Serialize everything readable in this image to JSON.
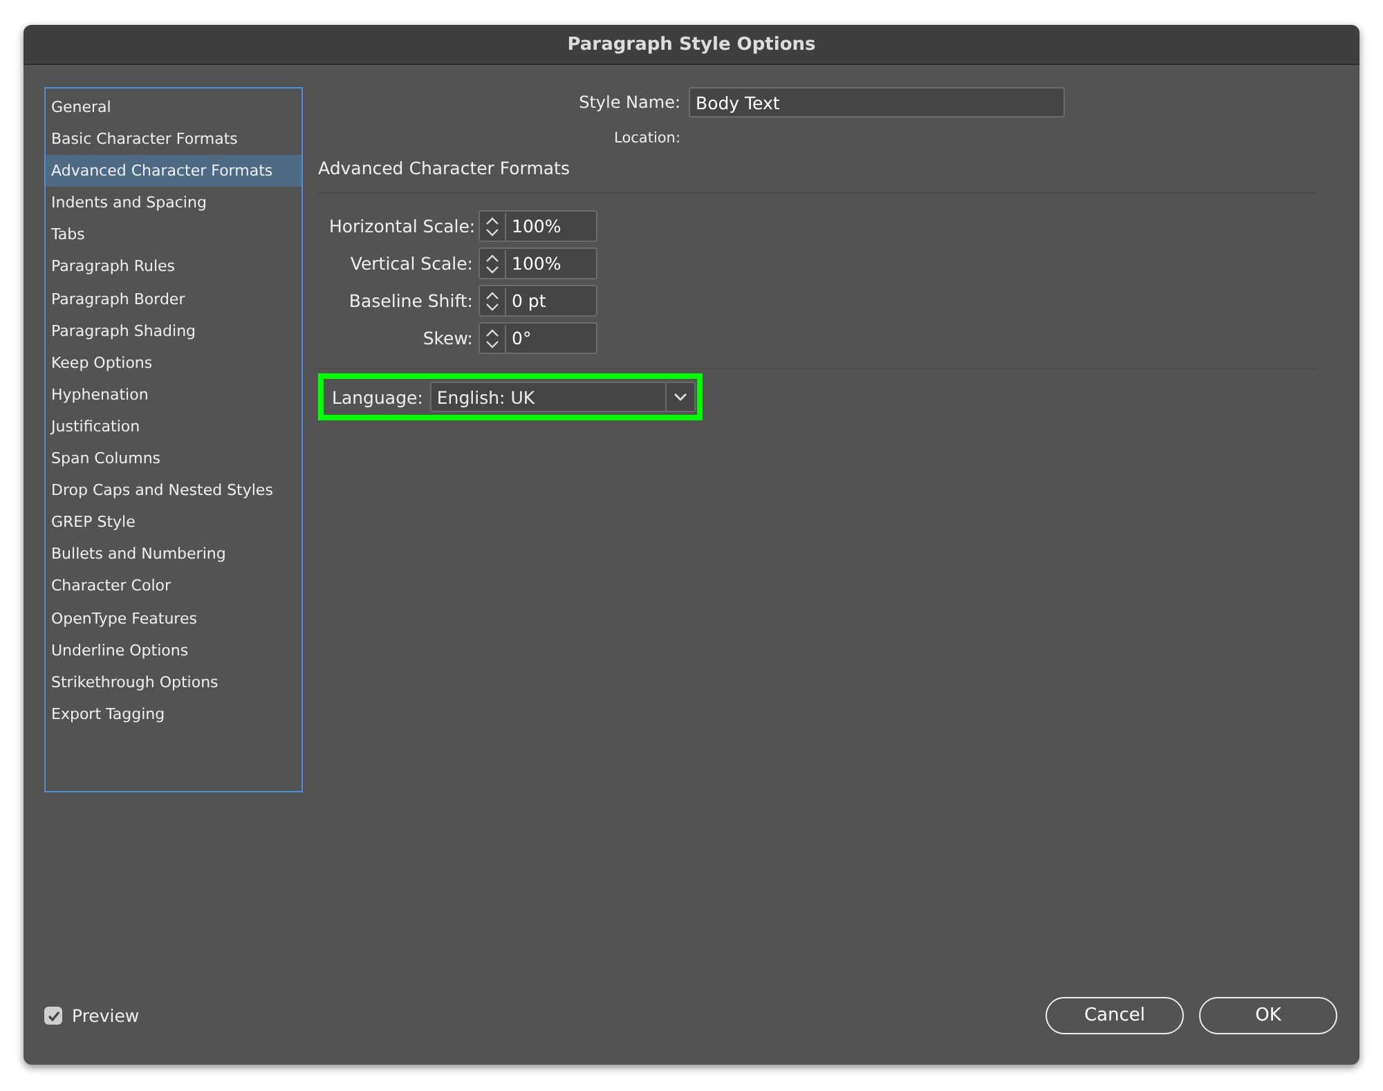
{
  "window": {
    "title": "Paragraph Style Options"
  },
  "sidebar": {
    "items": [
      {
        "label": "General",
        "selected": false
      },
      {
        "label": "Basic Character Formats",
        "selected": false
      },
      {
        "label": "Advanced Character Formats",
        "selected": true
      },
      {
        "label": "Indents and Spacing",
        "selected": false
      },
      {
        "label": "Tabs",
        "selected": false
      },
      {
        "label": "Paragraph Rules",
        "selected": false
      },
      {
        "label": "Paragraph Border",
        "selected": false
      },
      {
        "label": "Paragraph Shading",
        "selected": false
      },
      {
        "label": "Keep Options",
        "selected": false
      },
      {
        "label": "Hyphenation",
        "selected": false
      },
      {
        "label": "Justification",
        "selected": false
      },
      {
        "label": "Span Columns",
        "selected": false
      },
      {
        "label": "Drop Caps and Nested Styles",
        "selected": false
      },
      {
        "label": "GREP Style",
        "selected": false
      },
      {
        "label": "Bullets and Numbering",
        "selected": false
      },
      {
        "label": "Character Color",
        "selected": false
      },
      {
        "label": "OpenType Features",
        "selected": false
      },
      {
        "label": "Underline Options",
        "selected": false
      },
      {
        "label": "Strikethrough Options",
        "selected": false
      },
      {
        "label": "Export Tagging",
        "selected": false
      }
    ]
  },
  "style_name": {
    "label": "Style Name:",
    "value": "Body Text"
  },
  "location": {
    "label": "Location:"
  },
  "section_title": "Advanced Character Formats",
  "fields": [
    {
      "label": "Horizontal Scale:",
      "value": "100%"
    },
    {
      "label": "Vertical Scale:",
      "value": "100%"
    },
    {
      "label": "Baseline Shift:",
      "value": "0 pt"
    },
    {
      "label": "Skew:",
      "value": "0°"
    }
  ],
  "language": {
    "label": "Language:",
    "value": "English: UK"
  },
  "preview": {
    "label": "Preview",
    "checked": true
  },
  "buttons": [
    "Cancel",
    "OK"
  ]
}
